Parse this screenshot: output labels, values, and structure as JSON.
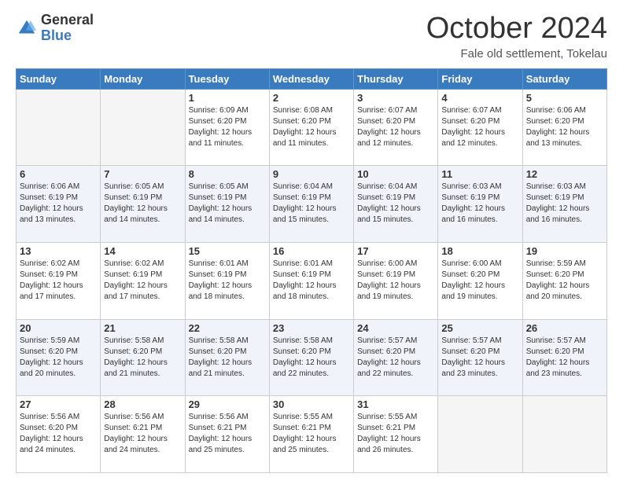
{
  "header": {
    "logo_general": "General",
    "logo_blue": "Blue",
    "month_title": "October 2024",
    "location": "Fale old settlement, Tokelau"
  },
  "days_of_week": [
    "Sunday",
    "Monday",
    "Tuesday",
    "Wednesday",
    "Thursday",
    "Friday",
    "Saturday"
  ],
  "weeks": [
    [
      {
        "day": "",
        "info": "",
        "empty": true
      },
      {
        "day": "",
        "info": "",
        "empty": true
      },
      {
        "day": "1",
        "info": "Sunrise: 6:09 AM\nSunset: 6:20 PM\nDaylight: 12 hours and 11 minutes."
      },
      {
        "day": "2",
        "info": "Sunrise: 6:08 AM\nSunset: 6:20 PM\nDaylight: 12 hours and 11 minutes."
      },
      {
        "day": "3",
        "info": "Sunrise: 6:07 AM\nSunset: 6:20 PM\nDaylight: 12 hours and 12 minutes."
      },
      {
        "day": "4",
        "info": "Sunrise: 6:07 AM\nSunset: 6:20 PM\nDaylight: 12 hours and 12 minutes."
      },
      {
        "day": "5",
        "info": "Sunrise: 6:06 AM\nSunset: 6:20 PM\nDaylight: 12 hours and 13 minutes."
      }
    ],
    [
      {
        "day": "6",
        "info": "Sunrise: 6:06 AM\nSunset: 6:19 PM\nDaylight: 12 hours and 13 minutes."
      },
      {
        "day": "7",
        "info": "Sunrise: 6:05 AM\nSunset: 6:19 PM\nDaylight: 12 hours and 14 minutes."
      },
      {
        "day": "8",
        "info": "Sunrise: 6:05 AM\nSunset: 6:19 PM\nDaylight: 12 hours and 14 minutes."
      },
      {
        "day": "9",
        "info": "Sunrise: 6:04 AM\nSunset: 6:19 PM\nDaylight: 12 hours and 15 minutes."
      },
      {
        "day": "10",
        "info": "Sunrise: 6:04 AM\nSunset: 6:19 PM\nDaylight: 12 hours and 15 minutes."
      },
      {
        "day": "11",
        "info": "Sunrise: 6:03 AM\nSunset: 6:19 PM\nDaylight: 12 hours and 16 minutes."
      },
      {
        "day": "12",
        "info": "Sunrise: 6:03 AM\nSunset: 6:19 PM\nDaylight: 12 hours and 16 minutes."
      }
    ],
    [
      {
        "day": "13",
        "info": "Sunrise: 6:02 AM\nSunset: 6:19 PM\nDaylight: 12 hours and 17 minutes."
      },
      {
        "day": "14",
        "info": "Sunrise: 6:02 AM\nSunset: 6:19 PM\nDaylight: 12 hours and 17 minutes."
      },
      {
        "day": "15",
        "info": "Sunrise: 6:01 AM\nSunset: 6:19 PM\nDaylight: 12 hours and 18 minutes."
      },
      {
        "day": "16",
        "info": "Sunrise: 6:01 AM\nSunset: 6:19 PM\nDaylight: 12 hours and 18 minutes."
      },
      {
        "day": "17",
        "info": "Sunrise: 6:00 AM\nSunset: 6:19 PM\nDaylight: 12 hours and 19 minutes."
      },
      {
        "day": "18",
        "info": "Sunrise: 6:00 AM\nSunset: 6:20 PM\nDaylight: 12 hours and 19 minutes."
      },
      {
        "day": "19",
        "info": "Sunrise: 5:59 AM\nSunset: 6:20 PM\nDaylight: 12 hours and 20 minutes."
      }
    ],
    [
      {
        "day": "20",
        "info": "Sunrise: 5:59 AM\nSunset: 6:20 PM\nDaylight: 12 hours and 20 minutes."
      },
      {
        "day": "21",
        "info": "Sunrise: 5:58 AM\nSunset: 6:20 PM\nDaylight: 12 hours and 21 minutes."
      },
      {
        "day": "22",
        "info": "Sunrise: 5:58 AM\nSunset: 6:20 PM\nDaylight: 12 hours and 21 minutes."
      },
      {
        "day": "23",
        "info": "Sunrise: 5:58 AM\nSunset: 6:20 PM\nDaylight: 12 hours and 22 minutes."
      },
      {
        "day": "24",
        "info": "Sunrise: 5:57 AM\nSunset: 6:20 PM\nDaylight: 12 hours and 22 minutes."
      },
      {
        "day": "25",
        "info": "Sunrise: 5:57 AM\nSunset: 6:20 PM\nDaylight: 12 hours and 23 minutes."
      },
      {
        "day": "26",
        "info": "Sunrise: 5:57 AM\nSunset: 6:20 PM\nDaylight: 12 hours and 23 minutes."
      }
    ],
    [
      {
        "day": "27",
        "info": "Sunrise: 5:56 AM\nSunset: 6:20 PM\nDaylight: 12 hours and 24 minutes."
      },
      {
        "day": "28",
        "info": "Sunrise: 5:56 AM\nSunset: 6:21 PM\nDaylight: 12 hours and 24 minutes."
      },
      {
        "day": "29",
        "info": "Sunrise: 5:56 AM\nSunset: 6:21 PM\nDaylight: 12 hours and 25 minutes."
      },
      {
        "day": "30",
        "info": "Sunrise: 5:55 AM\nSunset: 6:21 PM\nDaylight: 12 hours and 25 minutes."
      },
      {
        "day": "31",
        "info": "Sunrise: 5:55 AM\nSunset: 6:21 PM\nDaylight: 12 hours and 26 minutes."
      },
      {
        "day": "",
        "info": "",
        "empty": true
      },
      {
        "day": "",
        "info": "",
        "empty": true
      }
    ]
  ]
}
